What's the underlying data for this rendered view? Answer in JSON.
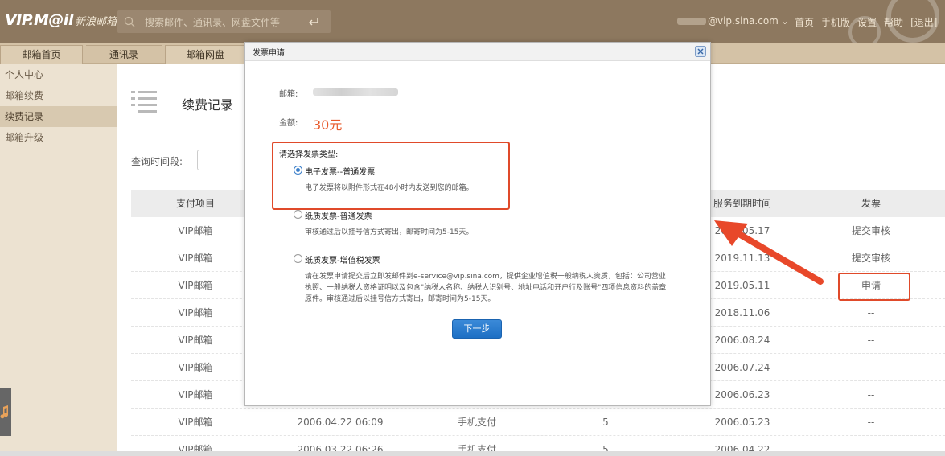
{
  "header": {
    "logo_main": "VIP.M@il",
    "logo_sub": "新浪邮箱",
    "search_placeholder": "搜索邮件、通讯录、网盘文件等",
    "account": "@vip.sina.com",
    "account_caret": "⌄",
    "nav": [
      "首页",
      "手机版",
      "设置",
      "帮助",
      "[退出]"
    ]
  },
  "tabs": [
    "邮箱首页",
    "通讯录",
    "邮箱网盘"
  ],
  "sidebar": {
    "items": [
      {
        "label": "个人中心",
        "active": false
      },
      {
        "label": "邮箱续费",
        "active": false
      },
      {
        "label": "续费记录",
        "active": true
      },
      {
        "label": "邮箱升级",
        "active": false
      }
    ]
  },
  "main": {
    "page_title": "续费记录",
    "query_label": "查询时间段:",
    "table": {
      "headers": [
        "支付项目",
        "",
        "",
        "",
        "服务到期时间",
        "发票"
      ],
      "rows": [
        {
          "item": "VIP邮箱",
          "time": "",
          "method": "",
          "months": "",
          "expire": "2019.05.17",
          "invoice": "提交审核"
        },
        {
          "item": "VIP邮箱",
          "time": "",
          "method": "",
          "months": "",
          "expire": "2019.11.13",
          "invoice": "提交审核"
        },
        {
          "item": "VIP邮箱",
          "time": "",
          "method": "",
          "months": "",
          "expire": "2019.05.11",
          "invoice": "申请"
        },
        {
          "item": "VIP邮箱",
          "time": "",
          "method": "",
          "months": "",
          "expire": "2018.11.06",
          "invoice": "--"
        },
        {
          "item": "VIP邮箱",
          "time": "",
          "method": "",
          "months": "",
          "expire": "2006.08.24",
          "invoice": "--"
        },
        {
          "item": "VIP邮箱",
          "time": "",
          "method": "",
          "months": "",
          "expire": "2006.07.24",
          "invoice": "--"
        },
        {
          "item": "VIP邮箱",
          "time": "",
          "method": "",
          "months": "",
          "expire": "2006.06.23",
          "invoice": "--"
        },
        {
          "item": "VIP邮箱",
          "time": "2006.04.22 06:09",
          "method": "手机支付",
          "months": "5",
          "expire": "2006.05.23",
          "invoice": "--"
        },
        {
          "item": "VIP邮箱",
          "time": "2006.03.22 06:26",
          "method": "手机支付",
          "months": "5",
          "expire": "2006.04.22",
          "invoice": "--"
        }
      ]
    }
  },
  "modal": {
    "title": "发票申请",
    "email_label": "邮箱:",
    "amount_label": "金额:",
    "amount": "30元",
    "choose_label": "请选择发票类型:",
    "options": [
      {
        "title": "电子发票--普通发票",
        "desc": "电子发票将以附件形式在48小时内发送到您的邮箱。",
        "checked": true
      },
      {
        "title": "纸质发票-普通发票",
        "desc": "审核通过后以挂号信方式寄出，邮寄时间为5-15天。",
        "checked": false
      },
      {
        "title": "纸质发票-增值税发票",
        "desc": "请在发票申请提交后立即发邮件到e-service@vip.sina.com，提供企业增值税一般纳税人资质，包括：公司营业执照、一般纳税人资格证明以及包含\"纳税人名称、纳税人识别号、地址电话和开户行及账号\"四项信息资料的盖章原件。审核通过后以挂号信方式寄出，邮寄时间为5-15天。",
        "checked": false
      }
    ],
    "next_label": "下一步"
  },
  "colors": {
    "topbar": "#8d785f",
    "accent_red": "#e04a2a",
    "amount": "#e8592a",
    "button_blue": "#1d6fc4"
  }
}
